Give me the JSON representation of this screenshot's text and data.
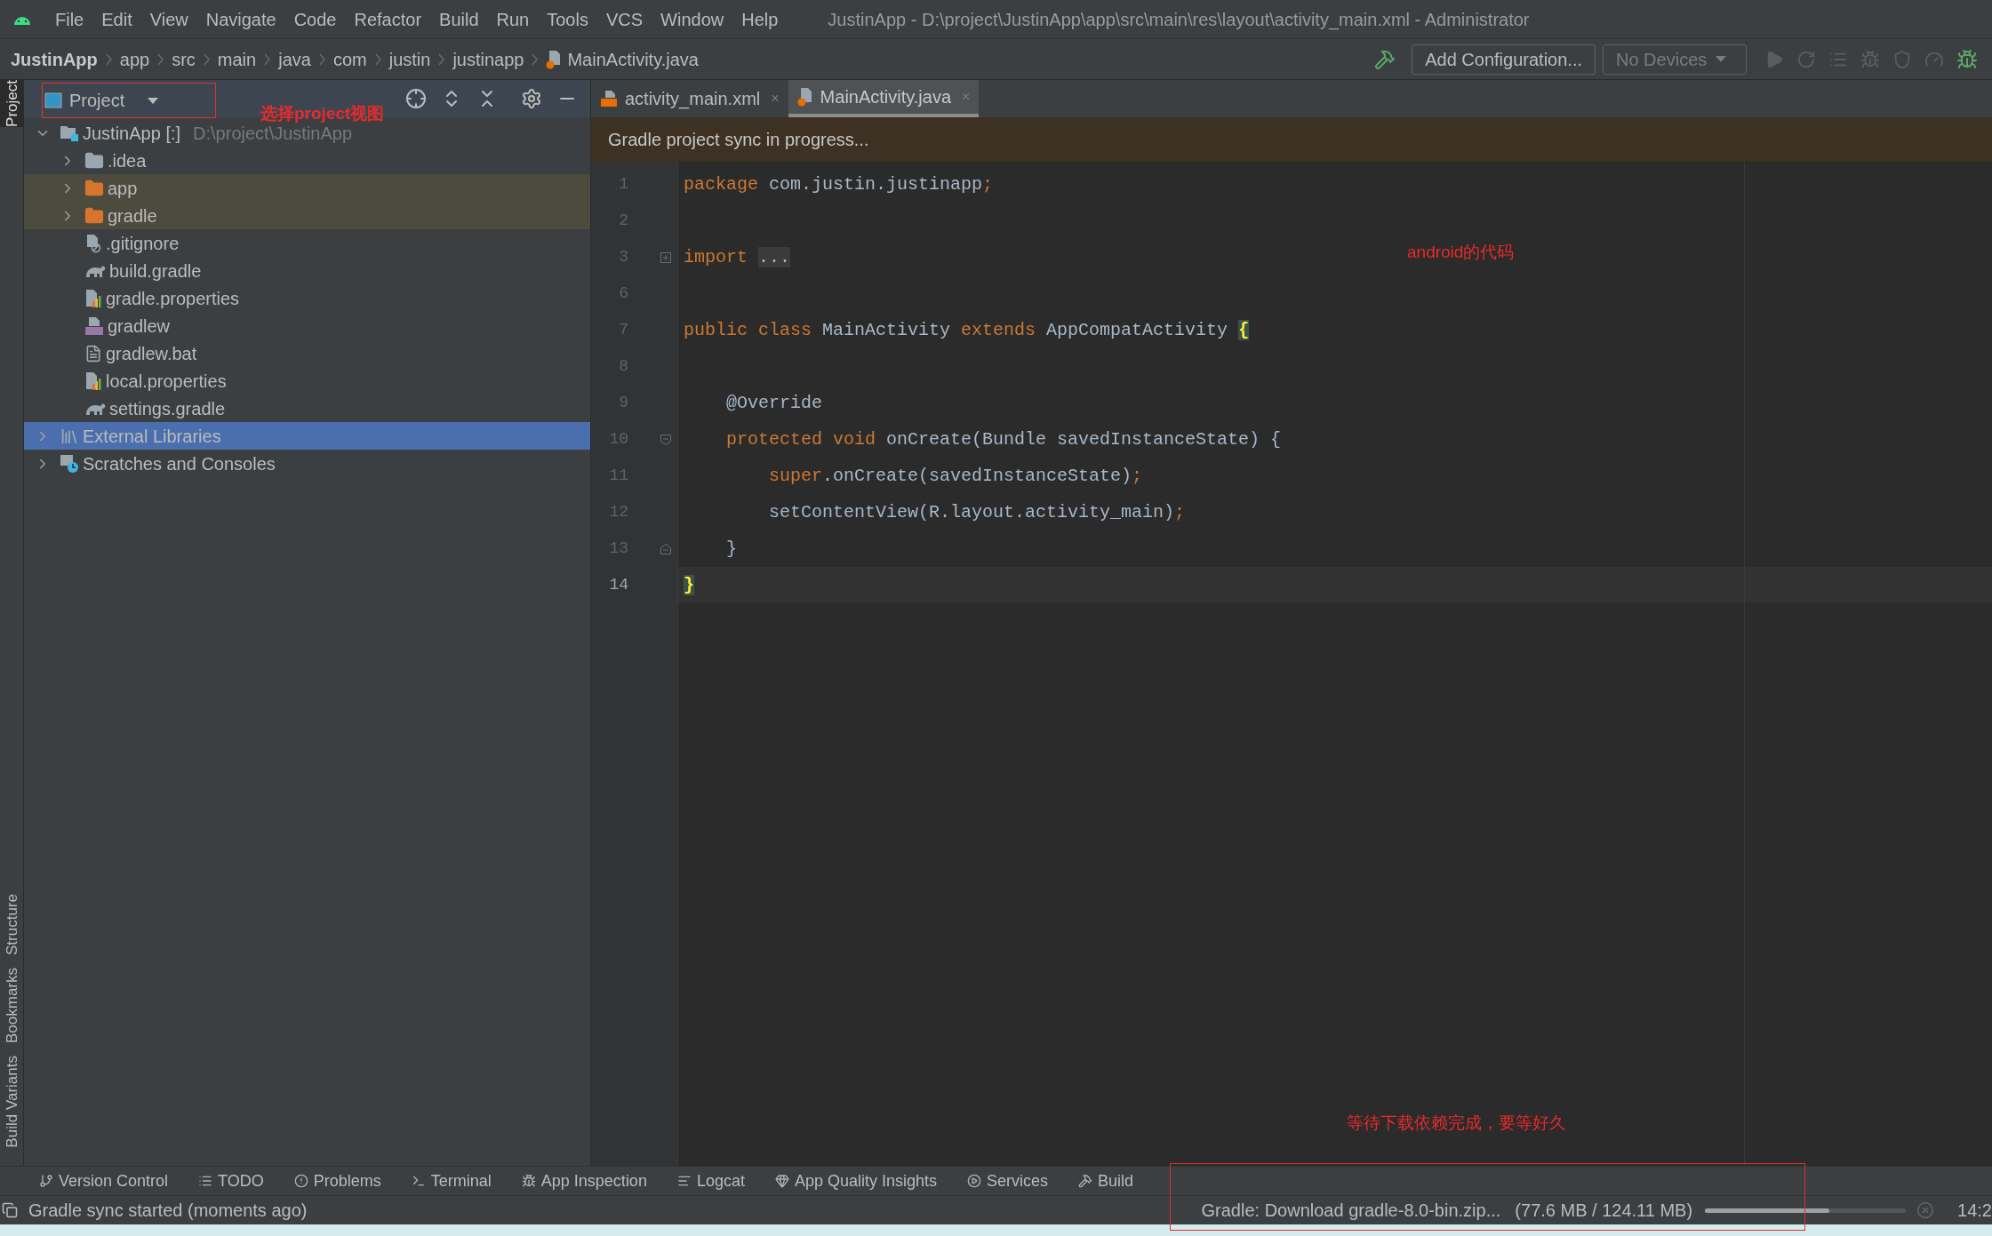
{
  "window": {
    "title": "JustinApp - D:\\project\\JustinApp\\app\\src\\main\\res\\layout\\activity_main.xml - Administrator"
  },
  "menu": [
    "File",
    "Edit",
    "View",
    "Navigate",
    "Code",
    "Refactor",
    "Build",
    "Run",
    "Tools",
    "VCS",
    "Window",
    "Help"
  ],
  "breadcrumb": [
    "JustinApp",
    "app",
    "src",
    "main",
    "java",
    "com",
    "justin",
    "justinapp",
    "MainActivity.java"
  ],
  "toolbar": {
    "config_button": "Add Configuration...",
    "device_select": "No Devices"
  },
  "side_tabs": [
    {
      "label": "Project",
      "selected": true
    },
    {
      "label": "Structure",
      "selected": false
    },
    {
      "label": "Bookmarks",
      "selected": false
    },
    {
      "label": "Build Variants",
      "selected": false
    }
  ],
  "project_panel": {
    "view_select": "Project",
    "tree": [
      {
        "label": "JustinApp [:]",
        "path": "D:\\project\\JustinApp",
        "kind": "module",
        "expanded": true,
        "selected": false,
        "children": [
          {
            "label": ".idea",
            "kind": "folder",
            "expanded": false,
            "marked": false,
            "selected": false
          },
          {
            "label": "app",
            "kind": "modulefolder",
            "expanded": false,
            "marked": true,
            "selected": false
          },
          {
            "label": "gradle",
            "kind": "modulefolder",
            "expanded": false,
            "marked": true,
            "selected": false
          },
          {
            "label": ".gitignore",
            "kind": "ignored",
            "marked": false,
            "selected": false
          },
          {
            "label": "build.gradle",
            "kind": "gradle",
            "marked": false,
            "selected": false
          },
          {
            "label": "gradle.properties",
            "kind": "properties",
            "marked": false,
            "selected": false
          },
          {
            "label": "gradlew",
            "kind": "script",
            "marked": false,
            "selected": false
          },
          {
            "label": "gradlew.bat",
            "kind": "text",
            "marked": false,
            "selected": false
          },
          {
            "label": "local.properties",
            "kind": "properties",
            "marked": false,
            "selected": false
          },
          {
            "label": "settings.gradle",
            "kind": "gradle",
            "marked": false,
            "selected": false
          }
        ]
      },
      {
        "label": "External Libraries",
        "kind": "libraries",
        "expanded": false,
        "selected": true
      },
      {
        "label": "Scratches and Consoles",
        "kind": "scratches",
        "expanded": false,
        "selected": false
      }
    ]
  },
  "editor": {
    "tabs": [
      {
        "label": "activity_main.xml",
        "kind": "xml",
        "close": "×",
        "selected": false
      },
      {
        "label": "MainActivity.java",
        "kind": "java",
        "close": "×",
        "selected": true
      }
    ],
    "banner": "Gradle project sync in progress...",
    "lines": [
      {
        "number": "1",
        "current": false,
        "kind": "top",
        "tokens": [
          {
            "kind": "keyword",
            "text": "package"
          },
          {
            "kind": "plain",
            "text": " com.justin.justinapp"
          },
          {
            "kind": "keyword",
            "text": ";"
          }
        ]
      },
      {
        "number": "2",
        "current": false,
        "kind": "top"
      },
      {
        "number": "3",
        "current": false,
        "kind": "top",
        "fold_marker": {
          "kind": "collapsed"
        },
        "tokens": [
          {
            "kind": "keyword",
            "text": "import"
          },
          {
            "kind": "fold",
            "text": "..."
          }
        ]
      },
      {
        "number": "6",
        "current": false,
        "kind": "top"
      },
      {
        "number": "7",
        "current": false,
        "kind": "top",
        "tokens": [
          {
            "kind": "keyword",
            "text": "public class"
          },
          {
            "kind": "plain",
            "text": " MainActivity "
          },
          {
            "kind": "keyword",
            "text": "extends"
          },
          {
            "kind": "plain",
            "text": " AppCompatActivity "
          },
          {
            "kind": "match",
            "text": "{"
          }
        ]
      },
      {
        "number": "8",
        "current": false,
        "kind": "top"
      },
      {
        "number": "9",
        "current": false,
        "kind": "member",
        "tokens": [
          {
            "kind": "plain",
            "text": "@Override"
          }
        ]
      },
      {
        "number": "10",
        "current": false,
        "kind": "member",
        "fold_marker": {
          "kind": "start"
        },
        "tokens": [
          {
            "kind": "keyword",
            "text": "protected void"
          },
          {
            "kind": "plain",
            "text": " onCreate(Bundle savedInstanceState) {"
          }
        ]
      },
      {
        "number": "11",
        "current": false,
        "kind": "statement",
        "tokens": [
          {
            "kind": "keyword",
            "text": "super"
          },
          {
            "kind": "plain",
            "text": ".onCreate(savedInstanceState)"
          },
          {
            "kind": "keyword",
            "text": ";"
          }
        ]
      },
      {
        "number": "12",
        "current": false,
        "kind": "statement",
        "tokens": [
          {
            "kind": "plain",
            "text": "setContentView(R.layout.activity_main)"
          },
          {
            "kind": "keyword",
            "text": ";"
          }
        ]
      },
      {
        "number": "13",
        "current": false,
        "kind": "member",
        "fold_marker": {
          "kind": "end"
        },
        "tokens": [
          {
            "kind": "plain",
            "text": "}"
          }
        ]
      },
      {
        "number": "14",
        "current": true,
        "kind": "top",
        "tokens": [
          {
            "kind": "match",
            "text": "}"
          }
        ]
      }
    ]
  },
  "tool_strip": [
    {
      "label": "Version Control",
      "kind": "vcs"
    },
    {
      "label": "TODO",
      "kind": "todo"
    },
    {
      "label": "Problems",
      "kind": "problems"
    },
    {
      "label": "Terminal",
      "kind": "terminal"
    },
    {
      "label": "App Inspection",
      "kind": "inspection"
    },
    {
      "label": "Logcat",
      "kind": "logcat"
    },
    {
      "label": "App Quality Insights",
      "kind": "insights"
    },
    {
      "label": "Services",
      "kind": "services"
    },
    {
      "label": "Build",
      "kind": "build"
    }
  ],
  "status_bar": {
    "message": "Gradle sync started (moments ago)",
    "task": "Gradle: Download gradle-8.0-bin.zip...",
    "task_size": "(77.6 MB / 124.11 MB)",
    "level": 0.62,
    "position": "14:2"
  },
  "annotations": [
    "选择project视图",
    "android的代码",
    "等待下载依赖完成，要等好久"
  ]
}
